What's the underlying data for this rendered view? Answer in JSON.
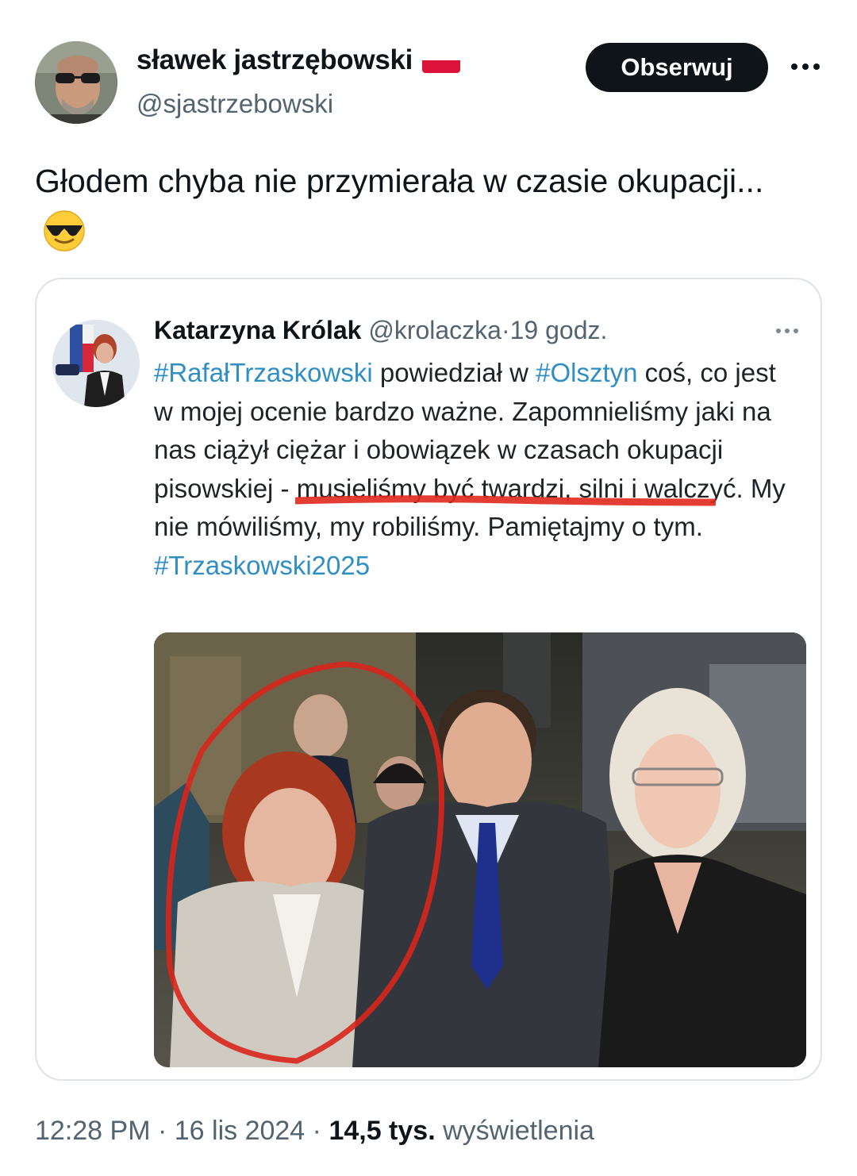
{
  "author": {
    "display_name": "sławek jastrzębowski",
    "handle": "@sjastrzebowski",
    "flag": "poland-flag"
  },
  "actions": {
    "follow_label": "Obserwuj",
    "more_icon": "more-horizontal-icon"
  },
  "tweet": {
    "text": "Głodem chyba nie przymierała w czasie okupacji...",
    "emoji": "smiling-face-with-sunglasses"
  },
  "quoted": {
    "display_name": "Katarzyna Królak",
    "handle": "@krolaczka",
    "separator": "·",
    "time": "19 godz.",
    "hashtag_1": "#RafałTrzaskowski",
    "text_1": " powiedział w ",
    "hashtag_2": "#Olsztyn",
    "text_2": " coś, co jest w mojej ocenie bardzo ważne. Zapomnieliśmy jaki na nas ciążył ciężar i obowiązek w czasach okupacji pisowskiej - musieliśmy być twardzi, silni i walczyć. My nie mówiliśmy, my robiliśmy. Pamiętajmy o tym.",
    "hashtag_3": "#Trzaskowski2025",
    "annotation_color": "#e0281e"
  },
  "footer": {
    "time": "12:28 PM",
    "sep1": " · ",
    "date": "16 lis 2024",
    "sep2": " · ",
    "views_count": "14,5 tys.",
    "views_label": " wyświetlenia"
  },
  "colors": {
    "text": "#0f1419",
    "secondary": "#536471",
    "hashtag": "#2f8fc4",
    "button_bg": "#0f1419",
    "border": "#dfe3e6"
  }
}
